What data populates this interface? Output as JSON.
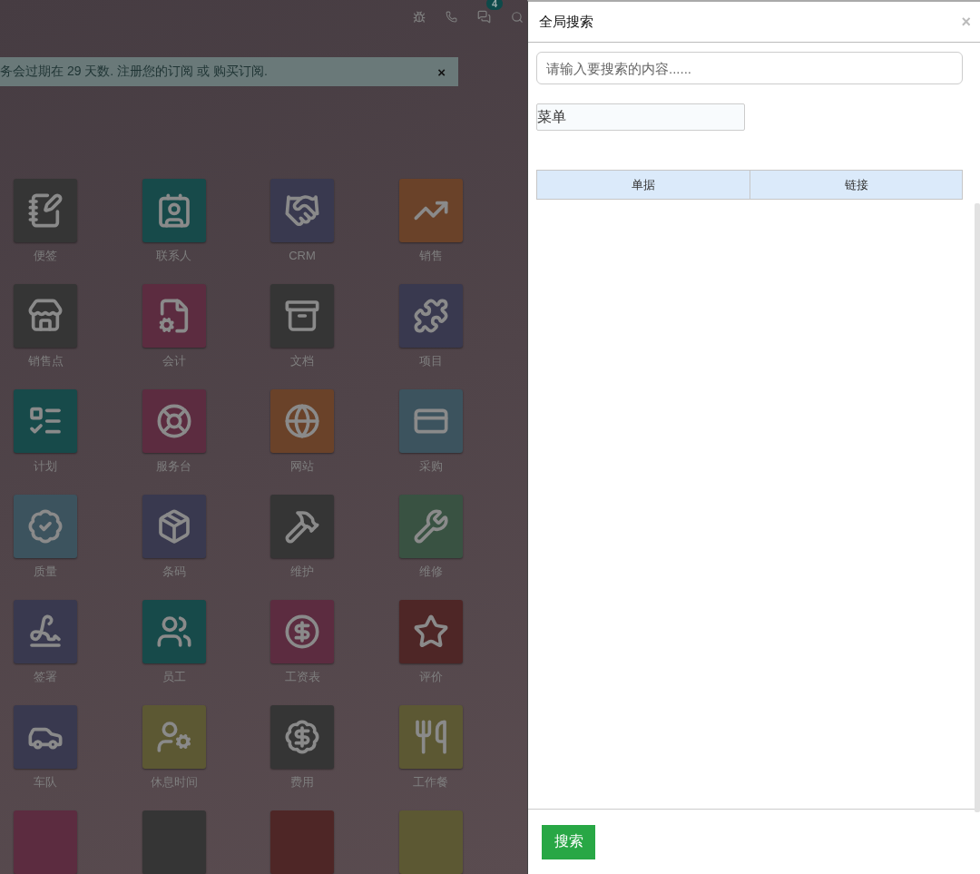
{
  "topbar": {
    "message_count": "4"
  },
  "banner": {
    "text": "务会过期在 29 天数. 注册您的订阅 或 购买订阅.",
    "close": "×"
  },
  "apps": [
    {
      "label": "便签",
      "color": "#353535"
    },
    {
      "label": "联系人",
      "color": "#174a4a"
    },
    {
      "label": "CRM",
      "color": "#39394f"
    },
    {
      "label": "销售",
      "color": "#6a4229"
    },
    {
      "label": "销售点",
      "color": "#353535"
    },
    {
      "label": "会计",
      "color": "#5c2c40"
    },
    {
      "label": "文档",
      "color": "#353535"
    },
    {
      "label": "项目",
      "color": "#39394f"
    },
    {
      "label": "计划",
      "color": "#174a4a"
    },
    {
      "label": "服务台",
      "color": "#5c2c40"
    },
    {
      "label": "网站",
      "color": "#6a4229"
    },
    {
      "label": "采购",
      "color": "#3c535e"
    },
    {
      "label": "质量",
      "color": "#3c535e"
    },
    {
      "label": "条码",
      "color": "#39394f"
    },
    {
      "label": "维护",
      "color": "#353535"
    },
    {
      "label": "维修",
      "color": "#395242"
    },
    {
      "label": "签署",
      "color": "#39394f"
    },
    {
      "label": "员工",
      "color": "#174a4a"
    },
    {
      "label": "工资表",
      "color": "#5c2c40"
    },
    {
      "label": "评价",
      "color": "#4e2626"
    },
    {
      "label": "车队",
      "color": "#39394f"
    },
    {
      "label": "休息时间",
      "color": "#5c5833"
    },
    {
      "label": "费用",
      "color": "#353535"
    },
    {
      "label": "工作餐",
      "color": "#5c5833"
    },
    {
      "color": "#5c2c40"
    },
    {
      "color": "#353535"
    },
    {
      "color": "#4e2626"
    },
    {
      "color": "#5c5833"
    }
  ],
  "search_panel": {
    "title": "全局搜索",
    "close": "×",
    "placeholder": "请输入要搜索的内容......",
    "category": "菜单",
    "table": {
      "columns": [
        "单据",
        "链接"
      ]
    },
    "button": "搜索"
  }
}
